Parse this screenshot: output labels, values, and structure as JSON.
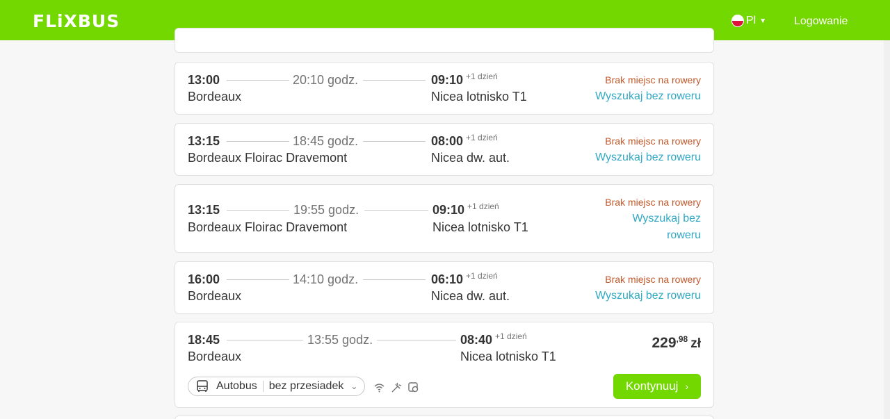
{
  "header": {
    "logo": "FLiXBUS",
    "language": "Pl",
    "login": "Logowanie"
  },
  "colors": {
    "brand": "#73d700",
    "warning": "#c0582a",
    "link": "#31a8c4"
  },
  "rides": [
    {
      "dep_time": "13:00",
      "dep_station": "Bordeaux",
      "duration": "20:10 godz.",
      "arr_time": "09:10",
      "plus_day": "+1 dzień",
      "arr_station": "Nicea lotnisko T1",
      "bike_status": "Brak miejsc na rowery",
      "search_link": "Wyszukaj bez roweru"
    },
    {
      "dep_time": "13:15",
      "dep_station": "Bordeaux Floirac Dravemont",
      "duration": "18:45 godz.",
      "arr_time": "08:00",
      "plus_day": "+1 dzień",
      "arr_station": "Nicea dw. aut.",
      "bike_status": "Brak miejsc na rowery",
      "search_link": "Wyszukaj bez roweru"
    },
    {
      "dep_time": "13:15",
      "dep_station": "Bordeaux Floirac Dravemont",
      "duration": "19:55 godz.",
      "arr_time": "09:10",
      "plus_day": "+1 dzień",
      "arr_station": "Nicea lotnisko T1",
      "bike_status": "Brak miejsc na rowery",
      "search_link_line1": "Wyszukaj bez",
      "search_link_line2": "roweru"
    },
    {
      "dep_time": "16:00",
      "dep_station": "Bordeaux",
      "duration": "14:10 godz.",
      "arr_time": "06:10",
      "plus_day": "+1 dzień",
      "arr_station": "Nicea dw. aut.",
      "bike_status": "Brak miejsc na rowery",
      "search_link": "Wyszukaj bez roweru"
    },
    {
      "dep_time": "18:45",
      "dep_station": "Bordeaux",
      "duration": "13:55 godz.",
      "arr_time": "08:40",
      "plus_day": "+1 dzień",
      "arr_station": "Nicea lotnisko T1",
      "price_main": "229",
      "price_cents": ",98",
      "currency": "zł",
      "transport": "Autobus",
      "transfer": "bez przesiadek",
      "amenities": [
        "wifi-icon",
        "power-plug-icon",
        "toilet-icon"
      ],
      "continue_label": "Kontynuuj"
    }
  ]
}
